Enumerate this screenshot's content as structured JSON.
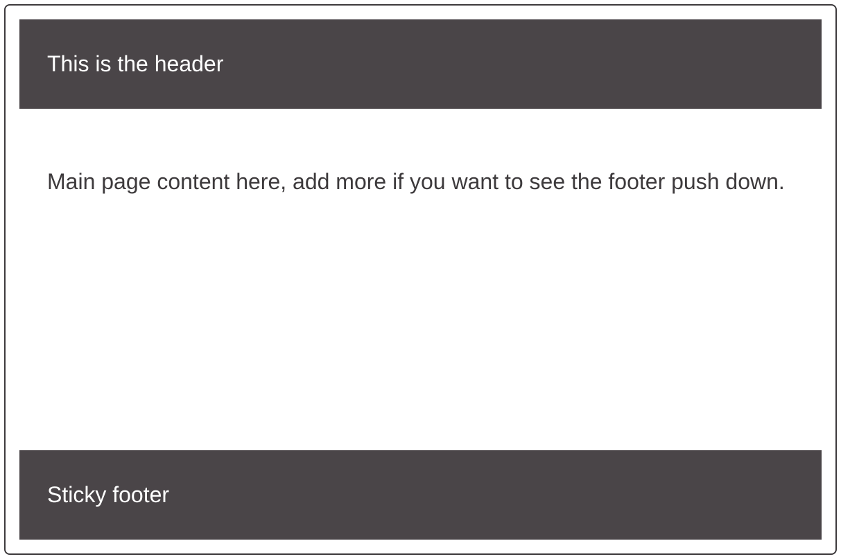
{
  "header": {
    "text": "This is the header"
  },
  "content": {
    "text": "Main page content here, add more if you want to see the footer push down."
  },
  "footer": {
    "text": "Sticky footer"
  }
}
